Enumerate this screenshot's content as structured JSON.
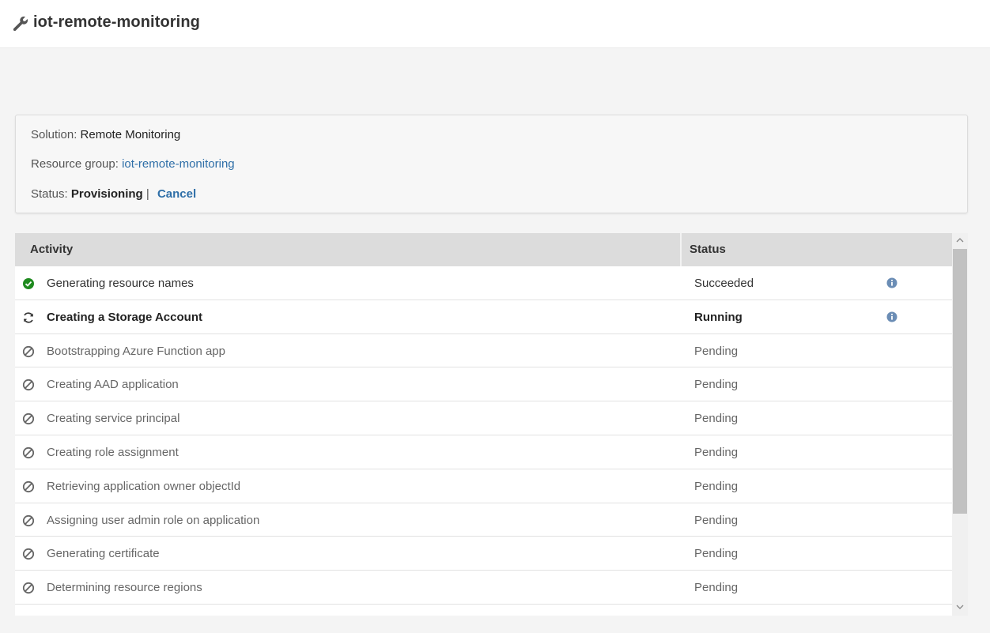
{
  "header": {
    "icon": "wrench-icon",
    "title": "iot-remote-monitoring"
  },
  "info": {
    "solution_label": "Solution:",
    "solution_value": "Remote Monitoring",
    "resource_group_label": "Resource group:",
    "resource_group_value": "iot-remote-monitoring",
    "status_label": "Status:",
    "status_value": "Provisioning",
    "separator": "|",
    "cancel_label": "Cancel"
  },
  "table": {
    "columns": [
      "Activity",
      "Status"
    ],
    "rows": [
      {
        "activity": "Generating resource names",
        "status": "Succeeded",
        "state": "succeeded",
        "icon": "check-circle-icon",
        "has_info": true
      },
      {
        "activity": "Creating a Storage Account",
        "status": "Running",
        "state": "running",
        "icon": "refresh-icon",
        "has_info": true
      },
      {
        "activity": "Bootstrapping Azure Function app",
        "status": "Pending",
        "state": "pending",
        "icon": "blocked-icon",
        "has_info": false
      },
      {
        "activity": "Creating AAD application",
        "status": "Pending",
        "state": "pending",
        "icon": "blocked-icon",
        "has_info": false
      },
      {
        "activity": "Creating service principal",
        "status": "Pending",
        "state": "pending",
        "icon": "blocked-icon",
        "has_info": false
      },
      {
        "activity": "Creating role assignment",
        "status": "Pending",
        "state": "pending",
        "icon": "blocked-icon",
        "has_info": false
      },
      {
        "activity": "Retrieving application owner objectId",
        "status": "Pending",
        "state": "pending",
        "icon": "blocked-icon",
        "has_info": false
      },
      {
        "activity": "Assigning user admin role on application",
        "status": "Pending",
        "state": "pending",
        "icon": "blocked-icon",
        "has_info": false
      },
      {
        "activity": "Generating certificate",
        "status": "Pending",
        "state": "pending",
        "icon": "blocked-icon",
        "has_info": false
      },
      {
        "activity": "Determining resource regions",
        "status": "Pending",
        "state": "pending",
        "icon": "blocked-icon",
        "has_info": false
      },
      {
        "activity": "",
        "status": "",
        "state": "pending",
        "icon": "blocked-icon",
        "has_info": false
      }
    ]
  },
  "colors": {
    "success": "#1e8a1e",
    "link": "#2f6fa8",
    "info_icon": "#6b8db5",
    "header_bg": "#dcdcdc"
  }
}
